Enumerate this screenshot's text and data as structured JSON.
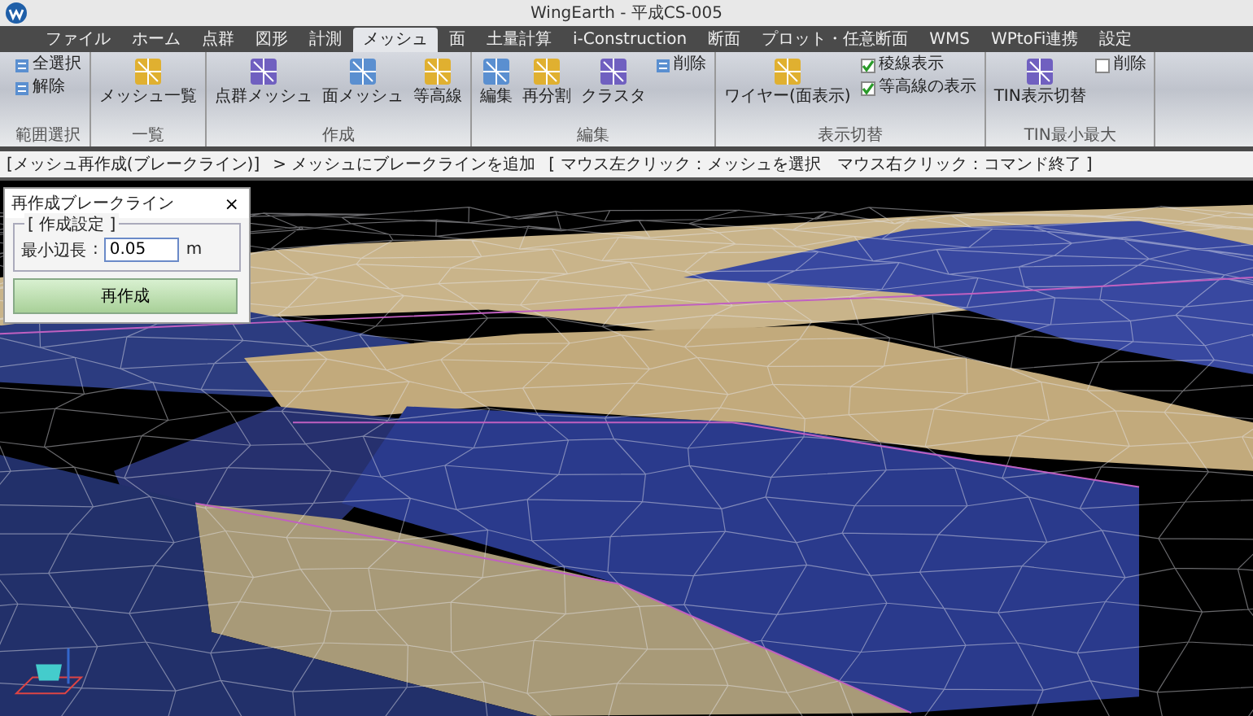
{
  "window": {
    "title": "WingEarth - 平成CS-005"
  },
  "menu_tabs": [
    {
      "label": "ファイル",
      "selected": false
    },
    {
      "label": "ホーム",
      "selected": false
    },
    {
      "label": "点群",
      "selected": false
    },
    {
      "label": "図形",
      "selected": false
    },
    {
      "label": "計測",
      "selected": false
    },
    {
      "label": "メッシュ",
      "selected": true
    },
    {
      "label": "面",
      "selected": false
    },
    {
      "label": "土量計算",
      "selected": false
    },
    {
      "label": "i-Construction",
      "selected": false
    },
    {
      "label": "断面",
      "selected": false
    },
    {
      "label": "プロット・任意断面",
      "selected": false
    },
    {
      "label": "WMS",
      "selected": false
    },
    {
      "label": "WPtoFi連携",
      "selected": false
    },
    {
      "label": "設定",
      "selected": false
    }
  ],
  "ribbon": {
    "groups": [
      {
        "label": "範囲選択",
        "buttons": [
          {
            "label": "全選択",
            "kind": "small"
          },
          {
            "label": "解除",
            "kind": "small"
          }
        ]
      },
      {
        "label": "一覧",
        "buttons": [
          {
            "label": "メッシュ一覧",
            "kind": "large"
          }
        ]
      },
      {
        "label": "作成",
        "buttons": [
          {
            "label": "点群メッシュ",
            "kind": "large"
          },
          {
            "label": "面メッシュ",
            "kind": "large"
          },
          {
            "label": "等高線",
            "kind": "large"
          }
        ]
      },
      {
        "label": "編集",
        "buttons": [
          {
            "label": "編集",
            "kind": "large"
          },
          {
            "label": "再分割",
            "kind": "large"
          },
          {
            "label": "クラスタ",
            "kind": "large"
          },
          {
            "label": "削除",
            "kind": "small"
          }
        ]
      },
      {
        "label": "表示切替",
        "buttons": [
          {
            "label": "ワイヤー(面表示)",
            "kind": "large"
          },
          {
            "label": "稜線表示",
            "kind": "check",
            "checked": true
          },
          {
            "label": "等高線の表示",
            "kind": "check",
            "checked": true
          }
        ]
      },
      {
        "label": "TIN最小最大",
        "buttons": [
          {
            "label": "TIN表示切替",
            "kind": "large"
          },
          {
            "label": "削除",
            "kind": "check",
            "checked": false
          }
        ]
      }
    ]
  },
  "status": {
    "command": "[メッシュ再作成(ブレークライン)]",
    "prompt": "> メッシュにブレークラインを追加",
    "hint": "[ マウス左クリック：メッシュを選択　マウス右クリック：コマンド終了 ]"
  },
  "dialog": {
    "title": "再作成ブレークライン",
    "close": "×",
    "section": "[ 作成設定 ]",
    "field_label": "最小辺長",
    "separator": ":",
    "value": "0.05",
    "unit": "m",
    "button": "再作成"
  }
}
